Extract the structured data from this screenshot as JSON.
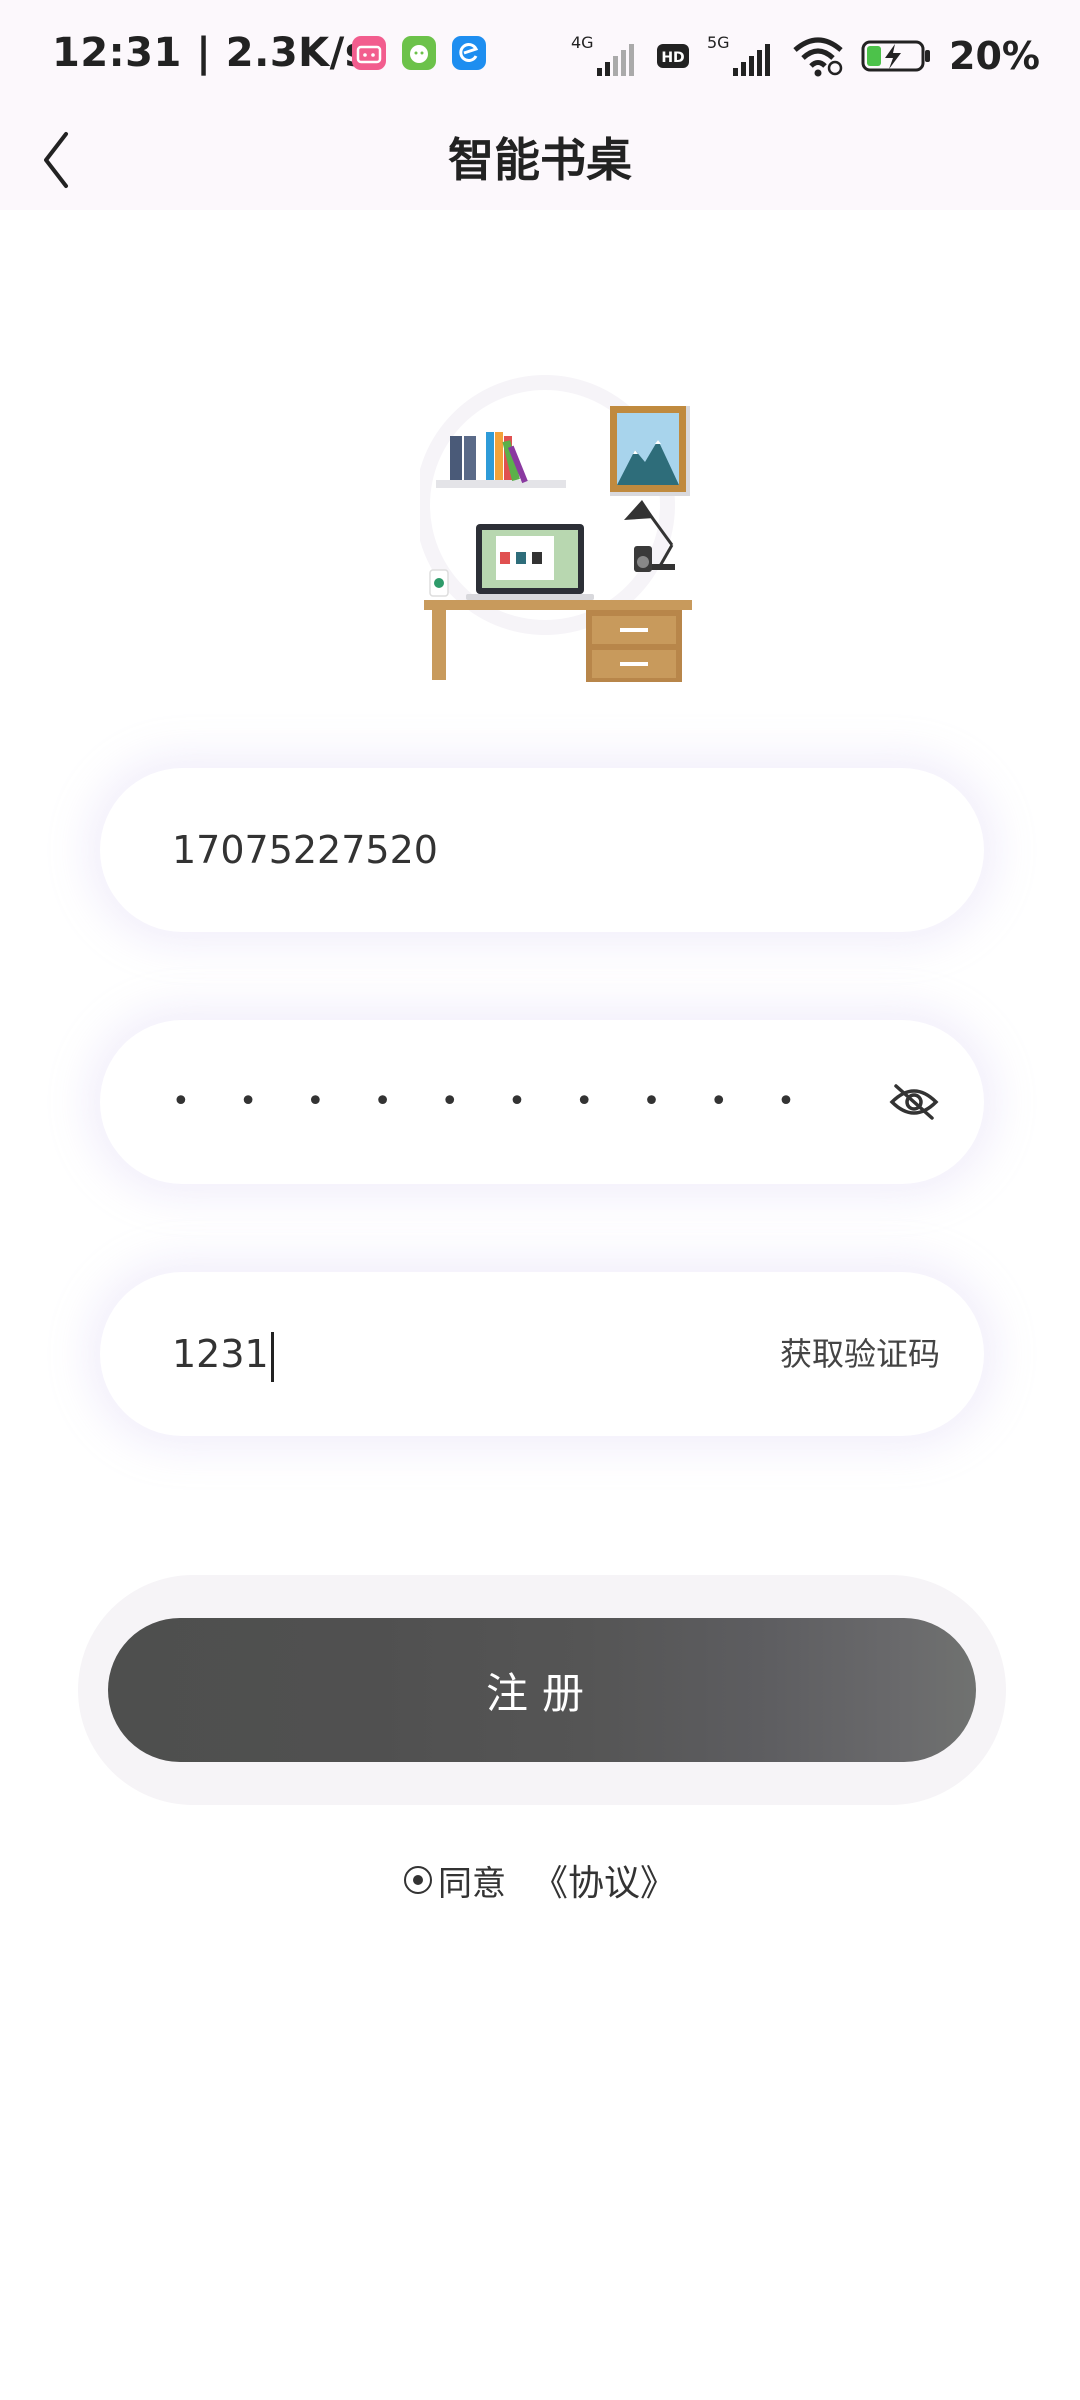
{
  "status_bar": {
    "time": "12:31 | 2.3K/s",
    "network_1": "4G",
    "network_2": "5G",
    "hd_badge": "HD",
    "battery_percent": "20%",
    "app_icons": [
      "bilibili-icon",
      "wechat-pet-icon",
      "edge-browser-icon"
    ]
  },
  "header": {
    "title": "智能书桌",
    "back_icon": "chevron-left-icon"
  },
  "form": {
    "phone_value": "17075227520",
    "password_masked": "• • • • • • • • • •",
    "password_toggle_icon": "eye-off-icon",
    "code_value": "1231",
    "get_code_label": "获取验证码"
  },
  "register_button": {
    "label": "注册"
  },
  "agreement": {
    "agree_label": "同意",
    "protocol_link": "《协议》",
    "checked": true
  },
  "colors": {
    "accent_button": "#555555",
    "top_band": "#fcf8fc",
    "field_shadow": "#f0ecfa"
  }
}
